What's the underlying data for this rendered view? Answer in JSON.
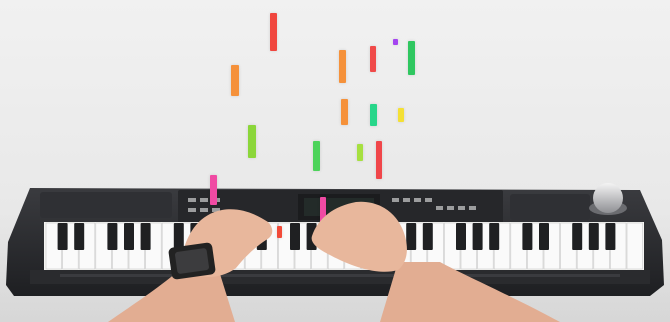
{
  "scene": {
    "background_color": "#ececec",
    "keyboard_body_color": "#2b2c2f",
    "skin_color": "#e8b79c",
    "watch_color": "#222222"
  },
  "falling_notes": [
    {
      "id": "note-1",
      "color": "#f0463e"
    },
    {
      "id": "note-2",
      "color": "#f5913a"
    },
    {
      "id": "note-3",
      "color": "#f5913a"
    },
    {
      "id": "note-4",
      "color": "#f04a49"
    },
    {
      "id": "note-5",
      "color": "#2fc760"
    },
    {
      "id": "note-6",
      "color": "#a444f0"
    },
    {
      "id": "note-7",
      "color": "#f5913a"
    },
    {
      "id": "note-8",
      "color": "#27d68a"
    },
    {
      "id": "note-9",
      "color": "#f4e035"
    },
    {
      "id": "note-10",
      "color": "#8bd63a"
    },
    {
      "id": "note-11",
      "color": "#4cd35a"
    },
    {
      "id": "note-12",
      "color": "#a6e040"
    },
    {
      "id": "note-13",
      "color": "#f0464a"
    },
    {
      "id": "note-14",
      "color": "#f04aa3"
    },
    {
      "id": "note-15",
      "color": "#f04aa3"
    },
    {
      "id": "note-16",
      "color": "#a6e040"
    },
    {
      "id": "note-17",
      "color": "#f24a38"
    }
  ]
}
